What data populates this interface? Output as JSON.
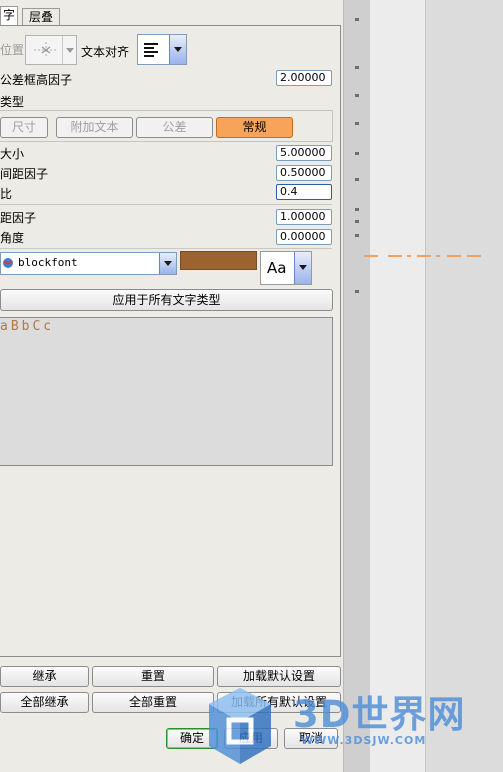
{
  "tabs": [
    "字",
    "层叠"
  ],
  "position": {
    "label": "位置",
    "text_align_label": "文本对齐"
  },
  "tolerance_frame_factor": {
    "label": "公差框高因子",
    "value": "2.00000"
  },
  "type_section": {
    "label": "类型",
    "buttons": [
      "尺寸",
      "附加文本",
      "公差",
      "常规"
    ],
    "active": "常规"
  },
  "fields": [
    {
      "label": "大小",
      "value": "5.00000"
    },
    {
      "label": "间距因子",
      "value": "0.50000"
    },
    {
      "label": "比",
      "value": "0.4"
    },
    {
      "label": "距因子",
      "value": "1.00000"
    },
    {
      "label": "角度",
      "value": "0.00000"
    }
  ],
  "font": {
    "name": "blockfont",
    "color": "#9b6330",
    "style_button": "Aa"
  },
  "apply_all_label": "应用于所有文字类型",
  "preview_text": "aBbCc",
  "bottom_buttons": {
    "row1": [
      "继承",
      "重置",
      "加载默认设置"
    ],
    "row2": [
      "全部继承",
      "全部重置",
      "加载所有默认设置"
    ],
    "dialog": [
      "确定",
      "应用",
      "取消"
    ]
  },
  "watermark": {
    "logo": "3D世界网",
    "url": "WWW.3DSJW.COM"
  },
  "colors": {
    "accent_orange": "#f7a35a",
    "preview_text": "#b07848",
    "dash": "#f4a05c"
  }
}
